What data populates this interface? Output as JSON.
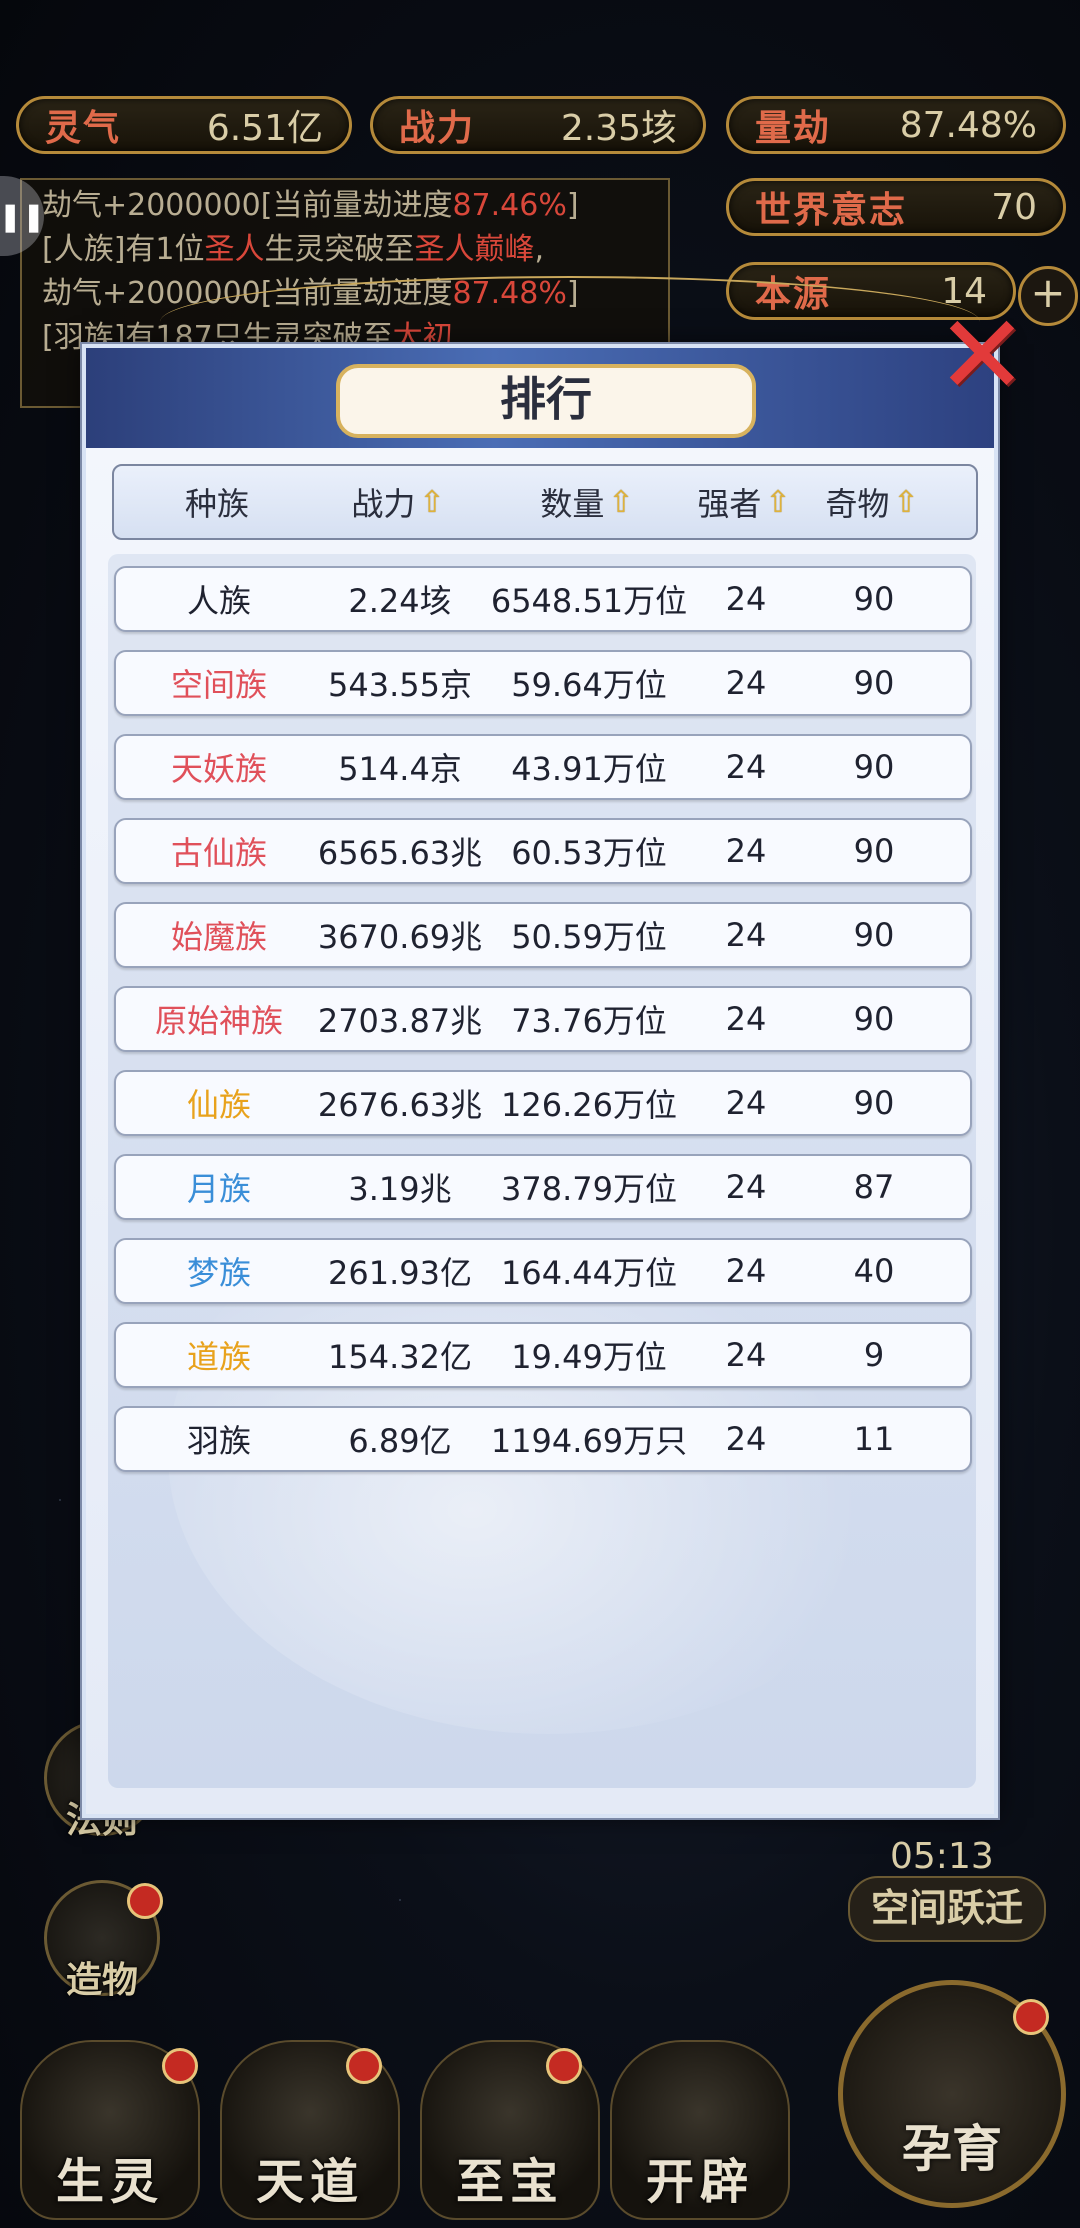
{
  "stats": {
    "lingqi": {
      "label": "灵气",
      "value": "6.51亿"
    },
    "zhanli": {
      "label": "战力",
      "value": "2.35垓"
    },
    "liangjie": {
      "label": "量劫",
      "value": "87.48%"
    },
    "world_will": {
      "label": "世界意志",
      "value": "70"
    },
    "benyuan": {
      "label": "本源",
      "value": "14"
    }
  },
  "log": {
    "line1_prefix": "劫气+2000000[当前量劫进度",
    "line1_red": "87.46%",
    "line1_suffix": "]",
    "line2_a": "[人族]有1位",
    "line2_red1": "圣人",
    "line2_b": "生灵突破至",
    "line2_red2": "圣人巅峰",
    "line2_c": ",",
    "line3_prefix": "劫气+2000000[当前量劫进度",
    "line3_red": "87.48%",
    "line3_suffix": "]",
    "line4_a": "[羽族]有187只",
    "line4_b": "生灵突破至",
    "line4_red": "太初"
  },
  "modal": {
    "title": "排行",
    "columns": [
      "种族",
      "战力",
      "数量",
      "强者",
      "奇物"
    ],
    "rows": [
      {
        "race": "人族",
        "power": "2.24垓",
        "count": "6548.51万位",
        "strong": "24",
        "items": "90",
        "color": "#1f2230"
      },
      {
        "race": "空间族",
        "power": "543.55京",
        "count": "59.64万位",
        "strong": "24",
        "items": "90",
        "color": "#e0505a"
      },
      {
        "race": "天妖族",
        "power": "514.4京",
        "count": "43.91万位",
        "strong": "24",
        "items": "90",
        "color": "#e0505a"
      },
      {
        "race": "古仙族",
        "power": "6565.63兆",
        "count": "60.53万位",
        "strong": "24",
        "items": "90",
        "color": "#e0505a"
      },
      {
        "race": "始魔族",
        "power": "3670.69兆",
        "count": "50.59万位",
        "strong": "24",
        "items": "90",
        "color": "#e0505a"
      },
      {
        "race": "原始神族",
        "power": "2703.87兆",
        "count": "73.76万位",
        "strong": "24",
        "items": "90",
        "color": "#e0505a"
      },
      {
        "race": "仙族",
        "power": "2676.63兆",
        "count": "126.26万位",
        "strong": "24",
        "items": "90",
        "color": "#e8a21c"
      },
      {
        "race": "月族",
        "power": "3.19兆",
        "count": "378.79万位",
        "strong": "24",
        "items": "87",
        "color": "#3a8ed8"
      },
      {
        "race": "梦族",
        "power": "261.93亿",
        "count": "164.44万位",
        "strong": "24",
        "items": "40",
        "color": "#3a8ed8"
      },
      {
        "race": "道族",
        "power": "154.32亿",
        "count": "19.49万位",
        "strong": "24",
        "items": "9",
        "color": "#e8a21c"
      },
      {
        "race": "羽族",
        "power": "6.89亿",
        "count": "1194.69万只",
        "strong": "24",
        "items": "11",
        "color": "#1f2230"
      }
    ]
  },
  "side": {
    "fa_ze": "法则",
    "zao_wu": "造物",
    "timer": "05:13",
    "jump": "空间跃迁"
  },
  "bottom": {
    "sheng_ling": "生灵",
    "tian_dao": "天道",
    "zhi_bao": "至宝",
    "kai_pi": "开辟",
    "yun_yu": "孕育"
  }
}
